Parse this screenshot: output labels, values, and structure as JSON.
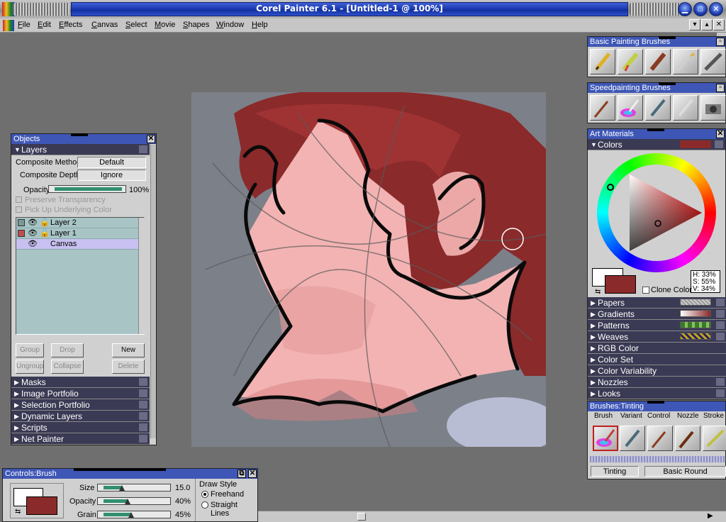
{
  "window": {
    "title": "Corel Painter 6.1 - [Untitled-1 @ 100%]"
  },
  "menu": [
    "File",
    "Edit",
    "Effects",
    "Canvas",
    "Select",
    "Movie",
    "Shapes",
    "Window",
    "Help"
  ],
  "objects": {
    "title": "Objects",
    "layers_label": "Layers",
    "composite_method_label": "Composite Method",
    "composite_method": "Default",
    "composite_depth_label": "Composite Depth",
    "composite_depth": "Ignore",
    "opacity_label": "Opacity",
    "opacity": "100%",
    "opacity_fraction": 1.0,
    "preserve_transparency": "Preserve Transparency",
    "pick_up_underlying": "Pick Up Underlying Color",
    "layers": [
      {
        "name": "Layer 2",
        "selected": false
      },
      {
        "name": "Layer 1",
        "selected": false
      },
      {
        "name": "Canvas",
        "selected": true
      }
    ],
    "buttons": {
      "group": "Group",
      "drop": "Drop",
      "new": "New",
      "ungroup": "Ungroup",
      "collapse": "Collapse",
      "delete": "Delete"
    },
    "sections": [
      "Masks",
      "Image Portfolio",
      "Selection Portfolio",
      "Dynamic Layers",
      "Scripts",
      "Net Painter"
    ]
  },
  "basic_brushes": {
    "title": "Basic Painting Brushes"
  },
  "speed_brushes": {
    "title": "Speedpainting Brushes"
  },
  "art_materials": {
    "title": "Art Materials",
    "colors_label": "Colors",
    "hsv": {
      "h": "H: 33%",
      "s": "S: 55%",
      "v": "V: 34%"
    },
    "clone_color": "Clone Color",
    "primary_color": "#8b2a2a",
    "secondary_color": "#ffffff",
    "sections": [
      "Papers",
      "Gradients",
      "Patterns",
      "Weaves",
      "RGB Color",
      "Color Set",
      "Color Variability",
      "Nozzles",
      "Looks"
    ]
  },
  "brushes_tinting": {
    "title": "Brushes:Tinting",
    "tabs": [
      "Brush",
      "Variant",
      "Control",
      "Nozzle",
      "Stroke"
    ],
    "brush": "Tinting",
    "variant": "Basic Round"
  },
  "controls": {
    "title": "Controls:Brush",
    "size_label": "Size",
    "size": "15.0",
    "size_fraction": 0.3,
    "opacity_label": "Opacity",
    "opacity": "40%",
    "opacity_fraction": 0.4,
    "grain_label": "Grain",
    "grain": "45%",
    "grain_fraction": 0.45,
    "draw_style_label": "Draw Style",
    "freehand": "Freehand",
    "straight_lines": "Straight Lines"
  }
}
